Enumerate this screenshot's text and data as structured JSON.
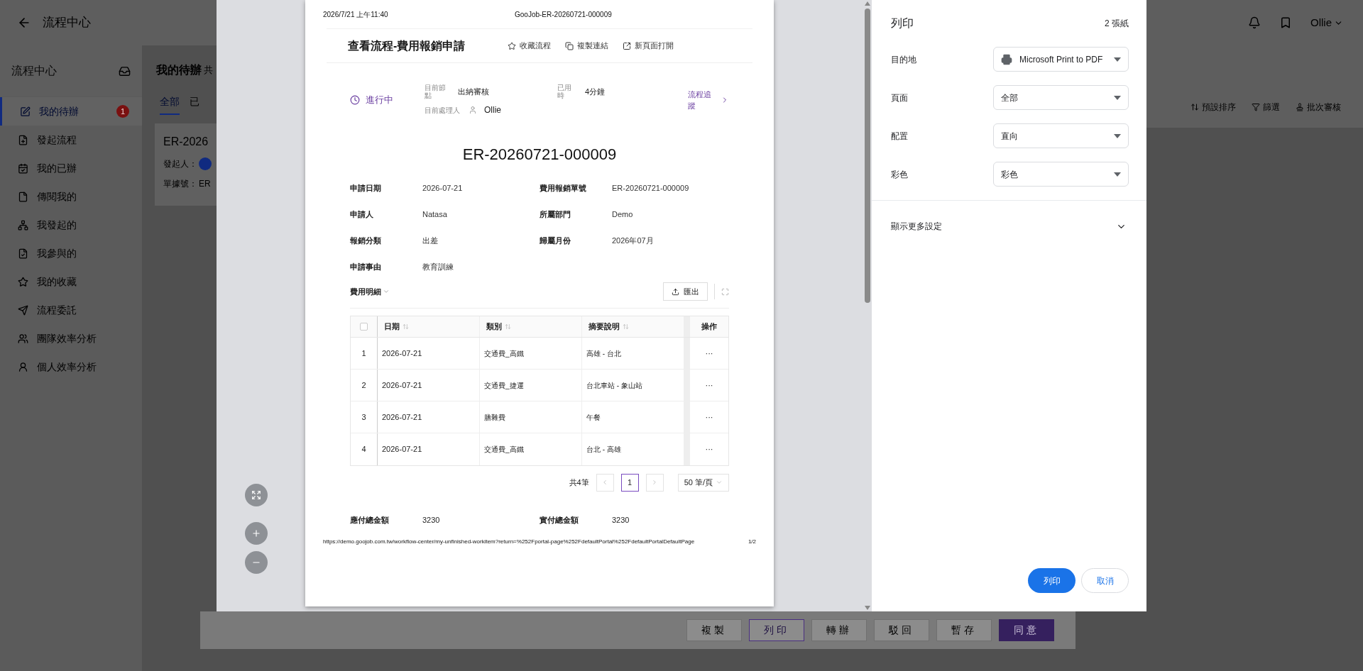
{
  "app_header": {
    "title": "流程中心",
    "user": "Ollie"
  },
  "sidebar": {
    "title": "流程中心",
    "items": [
      {
        "label": "我的待辦",
        "selected": true,
        "badge": "1"
      },
      {
        "label": "發起流程",
        "selected": false
      },
      {
        "label": "我的已辦",
        "selected": false
      },
      {
        "label": "傳閱我的",
        "selected": false
      },
      {
        "label": "我發起的",
        "selected": false
      },
      {
        "label": "我參與的",
        "selected": false
      },
      {
        "label": "我的收藏",
        "selected": false
      },
      {
        "label": "流程委託",
        "selected": false
      },
      {
        "label": "團隊效率分析",
        "selected": false
      },
      {
        "label": "個人效率分析",
        "selected": false
      }
    ]
  },
  "main": {
    "heading": "我的待辦",
    "heading_suffix": "共",
    "tabs": [
      {
        "label": "全部",
        "selected": true
      },
      {
        "label": "已",
        "selected": false
      }
    ],
    "card": {
      "title": "ER-2026",
      "fields": [
        {
          "label": "發起人："
        },
        {
          "label": "單據號：",
          "value": "ER"
        }
      ]
    },
    "toolbar": [
      "預設排序",
      "篩選",
      "批次審核"
    ],
    "action_buttons": [
      {
        "label": "複製",
        "kind": "default"
      },
      {
        "label": "列印",
        "kind": "outline"
      },
      {
        "label": "轉辦",
        "kind": "default"
      },
      {
        "label": "駁回",
        "kind": "default"
      },
      {
        "label": "暫存",
        "kind": "default"
      },
      {
        "label": "同意",
        "kind": "primary"
      }
    ]
  },
  "print_preview": {
    "page_header": {
      "date": "2026/7/21 上午11:40",
      "title": "GooJob-ER-20260721-000009"
    },
    "title": "查看流程-費用報銷申請",
    "actions": [
      "收藏流程",
      "複製連結",
      "新頁面打開"
    ],
    "status": "進行中",
    "node_label": "目前節點",
    "node_value": "出納審核",
    "elapsed_label": "已用時",
    "elapsed_value": "4分鐘",
    "handler_label": "目前處理人",
    "handler_value": "Ollie",
    "trace_link": "流程追蹤",
    "document_id": "ER-20260721-000009",
    "fields": [
      {
        "label": "申請日期",
        "value": "2026-07-21"
      },
      {
        "label": "費用報銷單號",
        "value": "ER-20260721-000009"
      },
      {
        "label": "申請人",
        "value": "Natasa"
      },
      {
        "label": "所屬部門",
        "value": "Demo"
      },
      {
        "label": "報銷分類",
        "value": "出差"
      },
      {
        "label": "歸屬月份",
        "value": "2026年07月"
      },
      {
        "label": "申請事由",
        "value": "教育訓練"
      }
    ],
    "detail_title": "費用明細",
    "export_button": "匯出",
    "table": {
      "select_all_checked": false,
      "columns": [
        "日期",
        "類別",
        "摘要說明",
        "操作"
      ],
      "rows": [
        {
          "index": "1",
          "date": "2026-07-21",
          "category": "交通費_高鐵",
          "description": "高雄 - 台北",
          "action": "···"
        },
        {
          "index": "2",
          "date": "2026-07-21",
          "category": "交通費_捷運",
          "description": "台北車站 - 象山站",
          "action": "···"
        },
        {
          "index": "3",
          "date": "2026-07-21",
          "category": "膳雜費",
          "description": "午餐",
          "action": "···"
        },
        {
          "index": "4",
          "date": "2026-07-21",
          "category": "交通費_高鐵",
          "description": "台北 - 高雄",
          "action": "···"
        }
      ]
    },
    "pagination": {
      "total": "共4筆",
      "pages": [
        {
          "label": "1",
          "selected": true
        }
      ],
      "page_size": "50 筆/頁"
    },
    "totals": [
      {
        "label": "應付總金額",
        "value": "3230"
      },
      {
        "label": "實付總金額",
        "value": "3230"
      }
    ],
    "page_footer": {
      "url": "https://demo.goojob.com.tw/workflow-center/my-unfinished-workitem?return=%252Fportal-page%252FdefaultPortal%252FdefaultPortalDefaultPage",
      "page": "1/2"
    }
  },
  "print_settings": {
    "title": "列印",
    "sheets": "2 張紙",
    "options": [
      {
        "label": "目的地",
        "value": "Microsoft Print to PDF",
        "kind": "printer"
      },
      {
        "label": "頁面",
        "value": "全部",
        "kind": "plain"
      },
      {
        "label": "配置",
        "value": "直向",
        "kind": "plain"
      },
      {
        "label": "彩色",
        "value": "彩色",
        "kind": "plain"
      }
    ],
    "more_settings": "顯示更多設定",
    "print_button": "列印",
    "cancel_button": "取消"
  }
}
